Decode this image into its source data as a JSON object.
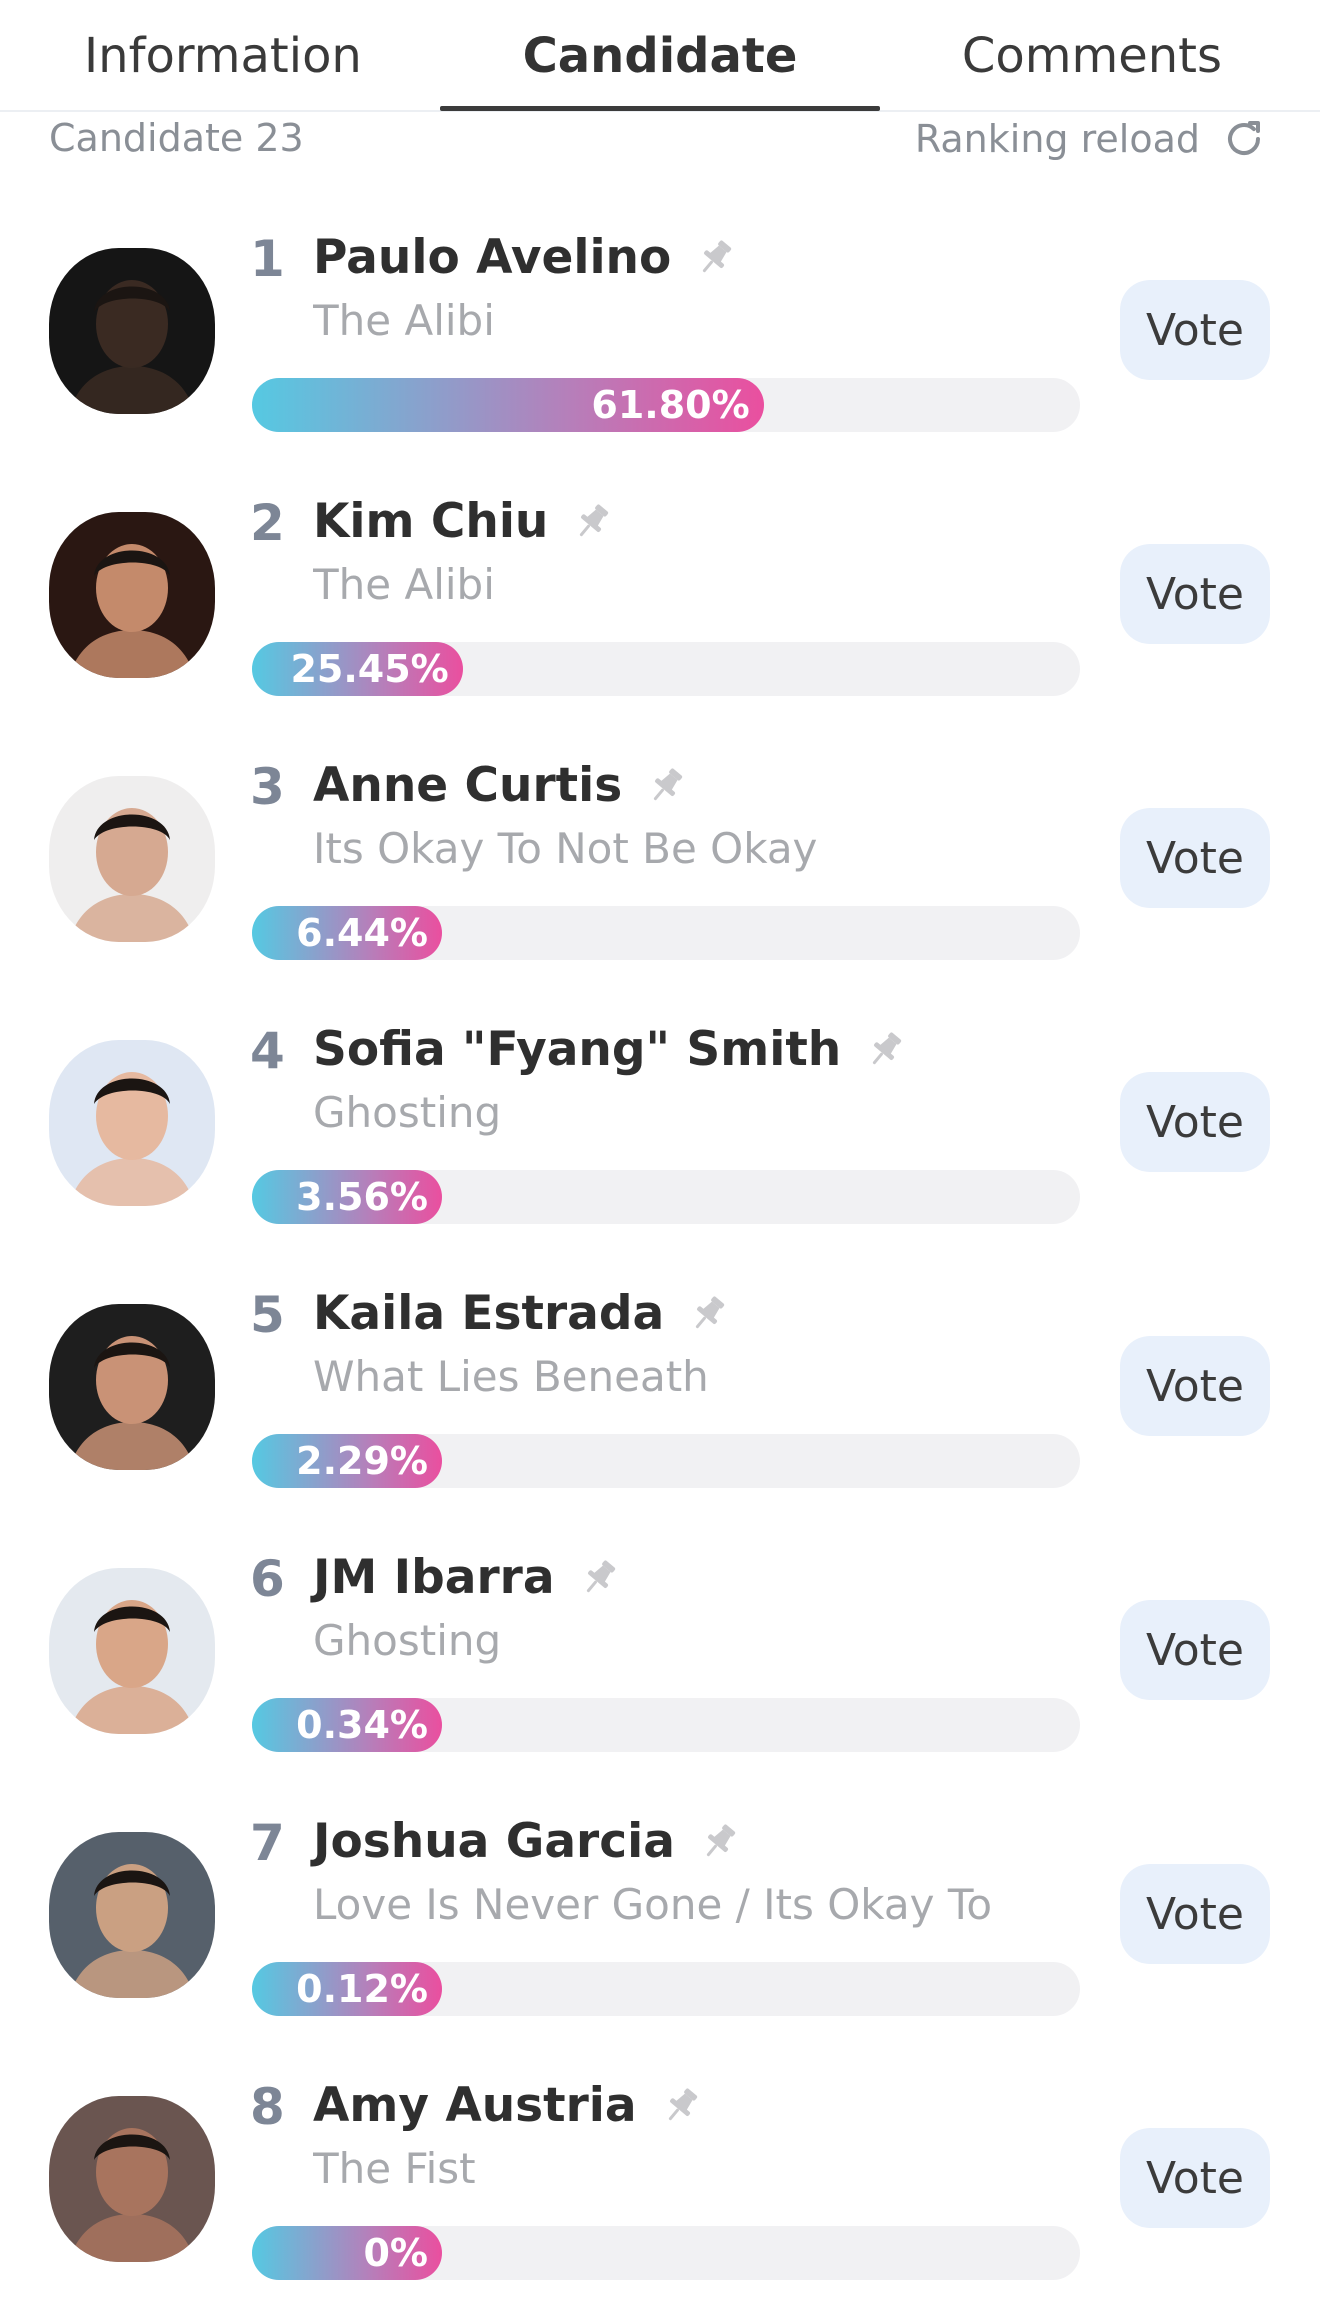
{
  "tabs": [
    {
      "label": "Information"
    },
    {
      "label": "Candidate"
    },
    {
      "label": "Comments"
    }
  ],
  "active_tab": "Candidate",
  "header": {
    "candidate_count": "Candidate 23",
    "ranking_reload_label": "Ranking reload",
    "reload_icon": "refresh-icon"
  },
  "colors": {
    "bar_gradient_start": "#55c9e2",
    "bar_gradient_end": "#ea4f9f",
    "vote_button_bg": "#e8f0fb",
    "track_bg": "#f1f1f3"
  },
  "candidates": [
    {
      "rank": "1",
      "name": "Paulo Avelino",
      "show": "The Alibi",
      "percent": "61.80%",
      "share": 61.8,
      "vote_label": "Vote",
      "avatar_tone": "#3a2a22",
      "avatar_bg": "#151515"
    },
    {
      "rank": "2",
      "name": "Kim Chiu",
      "show": "The Alibi",
      "percent": "25.45%",
      "share": 25.45,
      "vote_label": "Vote",
      "avatar_tone": "#c48a6b",
      "avatar_bg": "#2a1712"
    },
    {
      "rank": "3",
      "name": "Anne Curtis",
      "show": "Its Okay To Not Be Okay",
      "percent": "6.44%",
      "share": 6.44,
      "vote_label": "Vote",
      "avatar_tone": "#d6a991",
      "avatar_bg": "#efeeee"
    },
    {
      "rank": "4",
      "name": "Sofia \"Fyang\" Smith",
      "show": "Ghosting",
      "percent": "3.56%",
      "share": 3.56,
      "vote_label": "Vote",
      "avatar_tone": "#e6b9a0",
      "avatar_bg": "#dfe7f3"
    },
    {
      "rank": "5",
      "name": "Kaila Estrada",
      "show": "What Lies Beneath",
      "percent": "2.29%",
      "share": 2.29,
      "vote_label": "Vote",
      "avatar_tone": "#c99276",
      "avatar_bg": "#1e1e1e"
    },
    {
      "rank": "6",
      "name": "JM Ibarra",
      "show": "Ghosting",
      "percent": "0.34%",
      "share": 0.34,
      "vote_label": "Vote",
      "avatar_tone": "#d9a688",
      "avatar_bg": "#e4e9ef"
    },
    {
      "rank": "7",
      "name": "Joshua Garcia",
      "show": "Love Is Never Gone / Its Okay To...",
      "percent": "0.12%",
      "share": 0.12,
      "vote_label": "Vote",
      "avatar_tone": "#caa082",
      "avatar_bg": "#56606b"
    },
    {
      "rank": "8",
      "name": "Amy Austria",
      "show": "The Fist",
      "percent": "0%",
      "share": 0,
      "vote_label": "Vote",
      "avatar_tone": "#a8745e",
      "avatar_bg": "#6a5550"
    }
  ]
}
